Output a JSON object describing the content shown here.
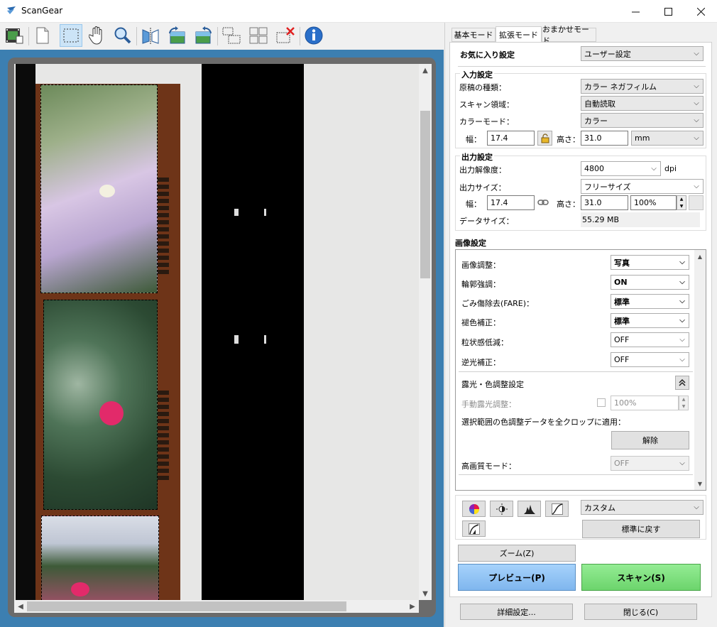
{
  "window": {
    "title": "ScanGear",
    "minimize_icon": "minimize-icon",
    "maximize_icon": "maximize-icon",
    "close_icon": "close-icon"
  },
  "toolbar": {
    "icons": [
      "thumbnail-view-icon",
      "whole-image-icon",
      "crop-frame-icon",
      "hand-icon",
      "zoom-icon",
      "mirror-icon",
      "rotate-left-icon",
      "rotate-right-icon",
      "auto-crop-icon",
      "select-all-crops-icon",
      "remove-crop-icon",
      "info-icon"
    ]
  },
  "tabs": [
    "基本モード",
    "拡張モード",
    "おまかせモード"
  ],
  "favorites": {
    "label": "お気に入り設定",
    "value": "ユーザー設定"
  },
  "input_settings": {
    "title": "入力設定",
    "source_label": "原稿の種類：",
    "source_value": "カラー ネガフィルム",
    "area_label": "スキャン領域：",
    "area_value": "自動読取",
    "color_label": "カラーモード：",
    "color_value": "カラー",
    "width_label": "幅：",
    "width_value": "17.4",
    "height_label": "高さ：",
    "height_value": "31.0",
    "unit_value": "mm"
  },
  "output_settings": {
    "title": "出力設定",
    "resolution_label": "出力解像度：",
    "resolution_value": "4800",
    "resolution_unit": "dpi",
    "size_label": "出力サイズ：",
    "size_value": "フリーサイズ",
    "width_label": "幅：",
    "width_value": "17.4",
    "height_label": "高さ：",
    "height_value": "31.0",
    "scale_value": "100%",
    "datasize_label": "データサイズ：",
    "datasize_value": "55.29 MB"
  },
  "image_settings": {
    "title": "画像設定",
    "rows": [
      {
        "label": "画像調整：",
        "value": "写真"
      },
      {
        "label": "輪郭強調：",
        "value": "ON"
      },
      {
        "label": "ごみ傷除去(FARE)：",
        "value": "標準"
      },
      {
        "label": "褪色補正：",
        "value": "標準"
      },
      {
        "label": "粒状感低減：",
        "value": "OFF"
      },
      {
        "label": "逆光補正：",
        "value": "OFF"
      }
    ],
    "exposure_title": "露光・色調整設定",
    "manual_exposure_label": "手動露光調整：",
    "manual_exposure_value": "100%",
    "apply_all_label": "選択範囲の色調整データを全クロップに適用：",
    "release_button": "解除",
    "hq_label": "高画質モード：",
    "hq_value": "OFF"
  },
  "adjust": {
    "icons": [
      "color-balance-icon",
      "brightness-contrast-icon",
      "histogram-icon",
      "tone-curve-icon",
      "final-review-icon"
    ],
    "preset_value": "カスタム",
    "reset_button": "標準に戻す"
  },
  "actions": {
    "zoom_button": "ズーム(Z)",
    "preview_button": "プレビュー(P)",
    "scan_button": "スキャン(S)",
    "preferences_button": "詳細設定...",
    "close_button": "閉じる(C)"
  },
  "colors": {
    "accent": "#3c7fb1",
    "preview_btn": "#8fc3f5",
    "scan_btn": "#7ee07e",
    "film_base": "#6e3418"
  }
}
